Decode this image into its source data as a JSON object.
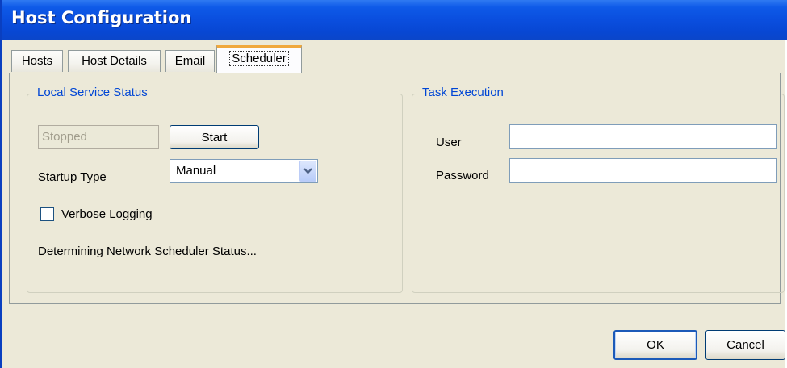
{
  "window": {
    "title": "Host Configuration"
  },
  "tabs": [
    {
      "label": "Hosts"
    },
    {
      "label": "Host Details"
    },
    {
      "label": "Email"
    },
    {
      "label": "Scheduler",
      "active": true
    }
  ],
  "local_service": {
    "legend": "Local Service Status",
    "status_value": "Stopped",
    "start_label": "Start",
    "startup_type_label": "Startup Type",
    "startup_type_value": "Manual",
    "verbose_label": "Verbose Logging",
    "verbose_checked": false,
    "status_message": "Determining Network Scheduler Status..."
  },
  "task_execution": {
    "legend": "Task Execution",
    "user_label": "User",
    "user_value": "",
    "password_label": "Password",
    "password_value": ""
  },
  "footer": {
    "ok_label": "OK",
    "cancel_label": "Cancel"
  },
  "icons": {
    "dropdown": "chevron-down-icon"
  },
  "colors": {
    "titlebar": "#0a4ede",
    "accent": "#0046d5",
    "tab_highlight": "#f0a83c"
  }
}
